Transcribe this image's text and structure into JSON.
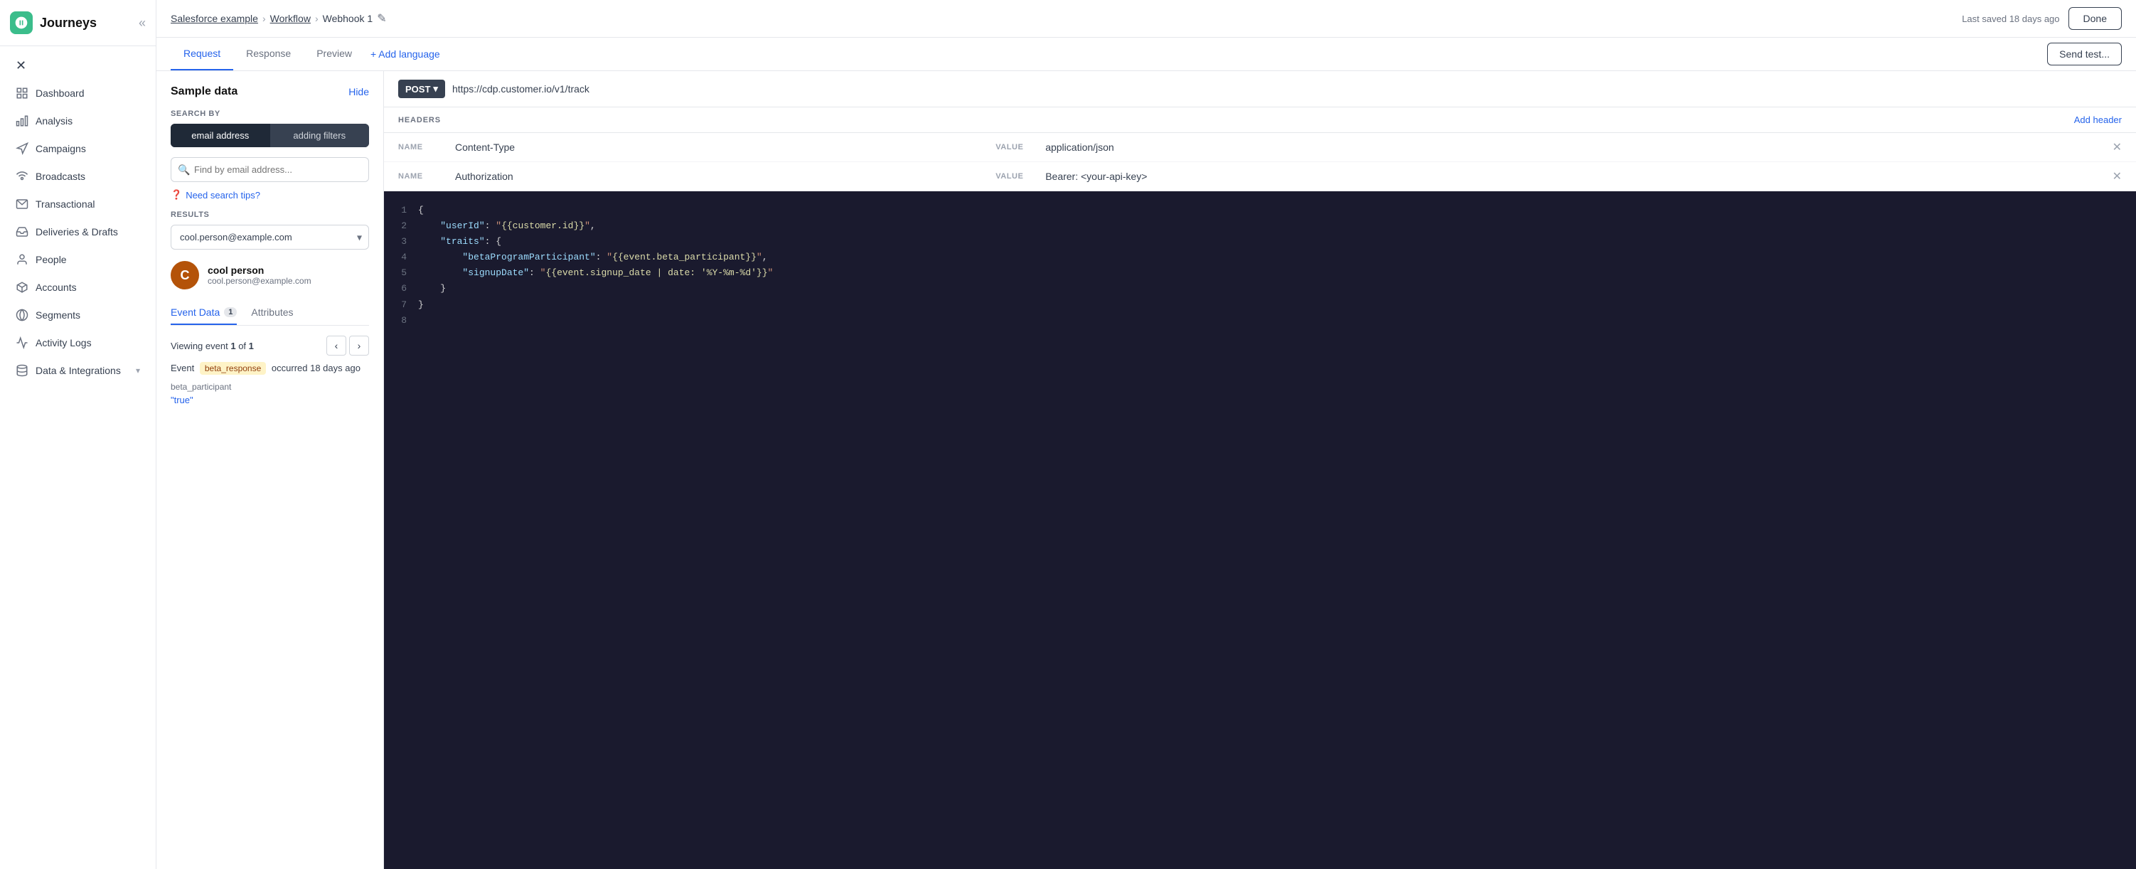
{
  "sidebar": {
    "logo_alt": "CustomerIO Logo",
    "title": "Journeys",
    "items": [
      {
        "id": "dashboard",
        "label": "Dashboard",
        "icon": "grid"
      },
      {
        "id": "analysis",
        "label": "Analysis",
        "icon": "bar-chart"
      },
      {
        "id": "campaigns",
        "label": "Campaigns",
        "icon": "megaphone"
      },
      {
        "id": "broadcasts",
        "label": "Broadcasts",
        "icon": "broadcast"
      },
      {
        "id": "transactional",
        "label": "Transactional",
        "icon": "mail"
      },
      {
        "id": "deliveries",
        "label": "Deliveries & Drafts",
        "icon": "inbox"
      },
      {
        "id": "people",
        "label": "People",
        "icon": "user"
      },
      {
        "id": "accounts",
        "label": "Accounts",
        "icon": "cube"
      },
      {
        "id": "segments",
        "label": "Segments",
        "icon": "segments"
      },
      {
        "id": "activity-logs",
        "label": "Activity Logs",
        "icon": "activity"
      },
      {
        "id": "data-integrations",
        "label": "Data & Integrations",
        "icon": "database"
      }
    ]
  },
  "breadcrumb": {
    "parent1": "Salesforce example",
    "parent2": "Workflow",
    "current": "Webhook 1"
  },
  "topbar": {
    "last_saved": "Last saved 18 days ago",
    "done_label": "Done"
  },
  "tabs": {
    "items": [
      {
        "id": "request",
        "label": "Request",
        "active": true
      },
      {
        "id": "response",
        "label": "Response",
        "active": false
      },
      {
        "id": "preview",
        "label": "Preview",
        "active": false
      }
    ],
    "add_language": "+ Add language",
    "send_test": "Send test..."
  },
  "sample_data": {
    "title": "Sample data",
    "hide_label": "Hide",
    "search_by_label": "SEARCH BY",
    "toggle_email": "email address",
    "toggle_filters": "adding filters",
    "search_placeholder": "Find by email address...",
    "search_tips": "Need search tips?",
    "results_label": "RESULTS",
    "result_value": "cool.person@example.com",
    "person_name": "cool person",
    "person_email": "cool.person@example.com",
    "avatar_letter": "C",
    "data_tab_event": "Event Data",
    "data_tab_event_count": "1",
    "data_tab_attributes": "Attributes",
    "viewing_text": "Viewing event",
    "viewing_num": "1",
    "viewing_of": "of",
    "viewing_total": "1",
    "event_label": "Event",
    "event_badge": "beta_response",
    "event_occurred": "occurred 18 days ago",
    "event_key": "beta_participant",
    "event_value": "\"true\""
  },
  "request": {
    "method": "POST",
    "url": "https://cdp.customer.io/v1/track",
    "headers_label": "HEADERS",
    "add_header": "Add header",
    "headers": [
      {
        "name_label": "NAME",
        "name": "Content-Type",
        "value_label": "VALUE",
        "value": "application/json"
      },
      {
        "name_label": "NAME",
        "name": "Authorization",
        "value_label": "VALUE",
        "value": "Bearer: <your-api-key>"
      }
    ],
    "code_lines": [
      {
        "num": "1",
        "code": "{"
      },
      {
        "num": "2",
        "code": "    \"userId\": \"{{customer.id}}\","
      },
      {
        "num": "3",
        "code": "    \"traits\": {"
      },
      {
        "num": "4",
        "code": "        \"betaProgramParticipant\": \"{{event.beta_participant}}\","
      },
      {
        "num": "5",
        "code": "        \"signupDate\": \"{{event.signup_date | date: '%Y-%m-%d'}}\""
      },
      {
        "num": "6",
        "code": "    }"
      },
      {
        "num": "7",
        "code": "}"
      },
      {
        "num": "8",
        "code": ""
      }
    ]
  }
}
